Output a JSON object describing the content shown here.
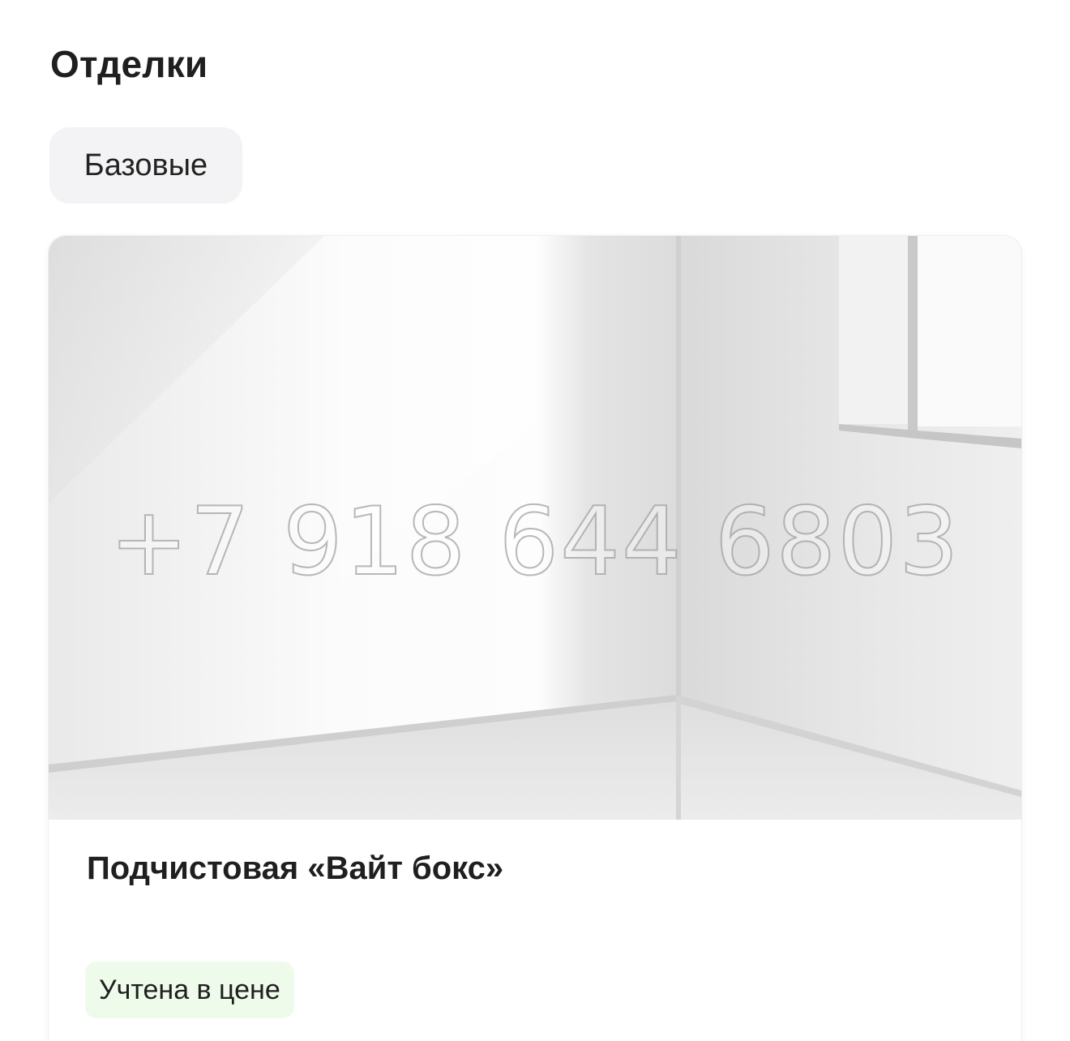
{
  "section": {
    "title": "Отделки"
  },
  "filter": {
    "chip_label": "Базовые"
  },
  "card": {
    "image_alt": "white-box-room-photo",
    "watermark": "+7 918 644 6803",
    "title": "Подчистовая «Вайт бокс»",
    "badge": "Учтена в цене"
  },
  "colors": {
    "chip_bg": "#f3f3f5",
    "badge_bg": "#effbea",
    "text": "#1f1f1f"
  }
}
